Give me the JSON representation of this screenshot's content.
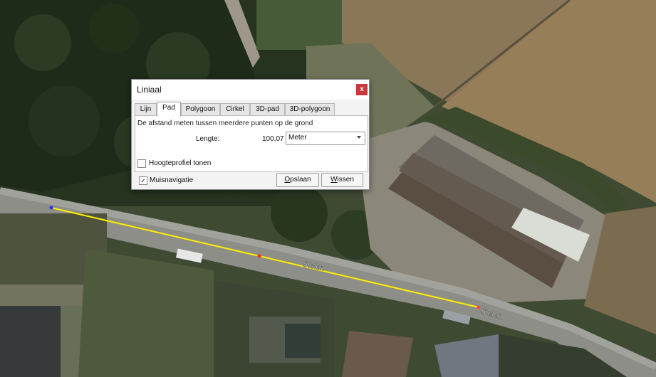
{
  "dialog": {
    "title": "Liniaal",
    "close_glyph": "x",
    "tabs": [
      "Lijn",
      "Pad",
      "Polygoon",
      "Cirkel",
      "3D-pad",
      "3D-polygoon"
    ],
    "active_tab": "Pad",
    "description": "De afstand meten tussen meerdere punten op de grond",
    "length_label": "Lengte:",
    "length_value": "100,07",
    "unit_selected": "Meter",
    "elevation_profile_label": "Hoogteprofiel tonen",
    "elevation_profile_checked": false,
    "mouse_nav_label": "Muisnavigatie",
    "mouse_nav_checked": true,
    "check_glyph": "✓",
    "save_first": "O",
    "save_rest": "pslaan",
    "clear_first": "W",
    "clear_rest": "issen"
  },
  "map": {
    "street_labels": [
      "Stelen",
      "Stelen"
    ],
    "path_color": "#ffee00",
    "start_point_color": "#2233ff",
    "mid_point_color": "#ff2222"
  }
}
